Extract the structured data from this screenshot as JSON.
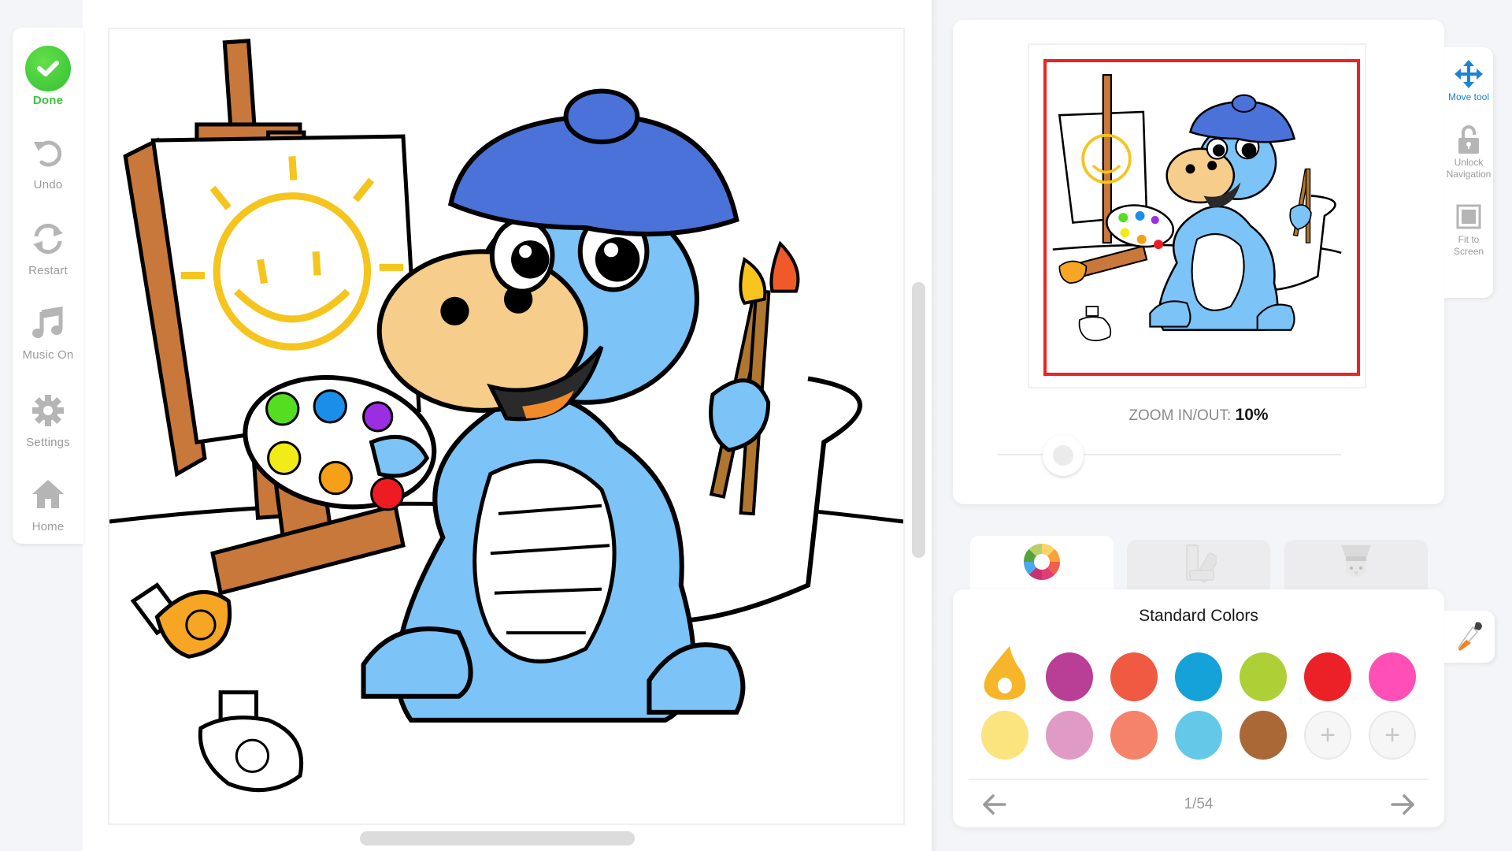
{
  "sidebar": {
    "items": [
      {
        "id": "done",
        "label": "Done",
        "icon": "checkmark-icon"
      },
      {
        "id": "undo",
        "label": "Undo",
        "icon": "undo-icon"
      },
      {
        "id": "restart",
        "label": "Restart",
        "icon": "restart-icon"
      },
      {
        "id": "music",
        "label": "Music On",
        "icon": "music-note-icon"
      },
      {
        "id": "settings",
        "label": "Settings",
        "icon": "gear-icon"
      },
      {
        "id": "home",
        "label": "Home",
        "icon": "home-icon"
      }
    ]
  },
  "canvas": {
    "artwork": "Blue dinosaur artist with beret, palette and brushes next to an easel with a smiling sun painting"
  },
  "navigator": {
    "zoom_label": "ZOOM IN/OUT:",
    "zoom_value": "10%",
    "zoom_fraction": 0.1,
    "viewport_color": "#ee2222"
  },
  "tools": {
    "items": [
      {
        "id": "move",
        "label": "Move tool",
        "icon": "move-arrows-icon",
        "active": true
      },
      {
        "id": "unlock",
        "label": "Unlock Navigation",
        "icon": "unlock-icon",
        "active": false
      },
      {
        "id": "fit",
        "label": "Fit to Screen",
        "icon": "fit-screen-icon",
        "active": false
      }
    ]
  },
  "tabs": [
    {
      "id": "colors",
      "icon": "color-wheel-icon",
      "active": true
    },
    {
      "id": "swatches",
      "icon": "swatch-book-icon",
      "active": false
    },
    {
      "id": "textures",
      "icon": "chef-hat-icon",
      "active": false
    }
  ],
  "palette": {
    "title": "Standard Colors",
    "selected_color": "#f7b52a",
    "colors": [
      "#f7b52a",
      "#b83e96",
      "#f05a42",
      "#15a2d8",
      "#acd035",
      "#ec2127",
      "#fd4fb5",
      "#fbe37e",
      "#df9ac5",
      "#f4836a",
      "#64c8e8",
      "#aa6836"
    ],
    "add_slots": 2,
    "add_label": "+",
    "page_indicator": "1/54"
  }
}
